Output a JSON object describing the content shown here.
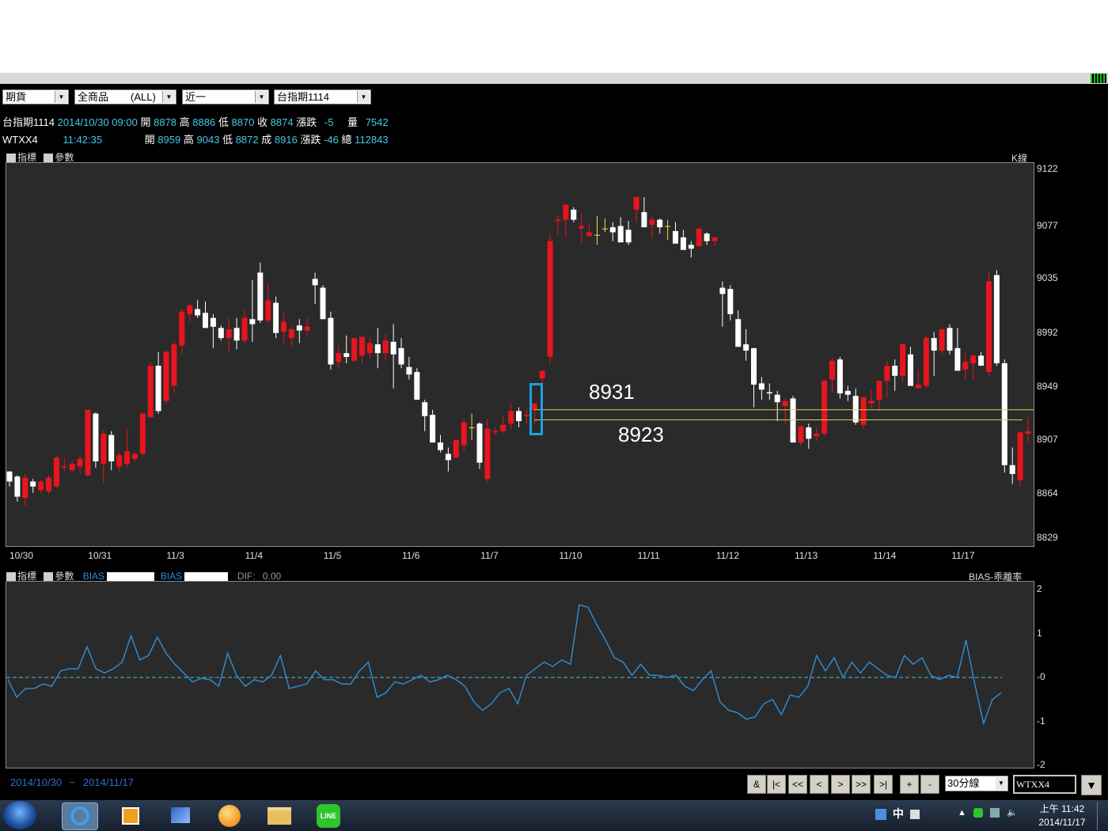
{
  "toolbar": {
    "market": "期貨",
    "products": "全商品",
    "products_filter": "(ALL)",
    "period": "近一",
    "symbol": "台指期1114"
  },
  "quotes": {
    "row1": {
      "name": "台指期1114",
      "datetime": "2014/10/30 09:00",
      "open_label": "開",
      "open": "8878",
      "high_label": "高",
      "high": "8886",
      "low_label": "低",
      "low": "8870",
      "close_label": "收",
      "close": "8874",
      "change_label": "漲跌",
      "change": "-5",
      "volume_label": "量",
      "volume": "7542"
    },
    "row2": {
      "name": "WTXX4",
      "time": "11:42:35",
      "open_label": "開",
      "open": "8959",
      "high_label": "高",
      "high": "9043",
      "low_label": "低",
      "low": "8872",
      "close_label": "成",
      "close": "8916",
      "change_label": "漲跌",
      "change": "-46",
      "volume_label": "總",
      "volume": "112843"
    }
  },
  "main_panel": {
    "indicator_btn": "指標",
    "param_btn": "參數",
    "chart_label": "K線",
    "y_ticks": [
      "9122",
      "9077",
      "9035",
      "8992",
      "8949",
      "8907",
      "8864",
      "8829"
    ],
    "annotation_high": "8931",
    "annotation_low": "8923"
  },
  "sub_panel": {
    "indicator_btn": "指標",
    "param_btn": "參數",
    "bias1_label": "BIAS",
    "bias2_label": "BIAS",
    "dif_label": "DIF:",
    "dif_value": "0.00",
    "chart_label": "BIAS-乖離率",
    "y_ticks": [
      "2",
      "1",
      "-0",
      "-1",
      "-2"
    ]
  },
  "footer": {
    "range_start": "2014/10/30",
    "range_sep": "~",
    "range_end": "2014/11/17",
    "nav": [
      "&",
      "|<",
      "<<",
      "<",
      ">",
      ">>",
      ">|",
      "+",
      "-"
    ],
    "interval": "30分線",
    "symbol_input": "WTXX4"
  },
  "taskbar": {
    "ime": "中",
    "time": "上午 11:42",
    "date": "2014/11/17"
  },
  "colors": {
    "up": "#e8141e",
    "down": "#ffffff",
    "flat": "#f0e040",
    "panel_bg": "#2a2a2a",
    "bias_line": "#2f8fd8",
    "zero_line": "#3fc6d9",
    "highlight_box": "#1da0e0",
    "level_lines": "#d8d040"
  },
  "chart_data": {
    "type": "candlestick",
    "title": "",
    "symbol": "台指期1114",
    "interval": "30分線",
    "x_dates": [
      "10/30",
      "10/31",
      "11/3",
      "11/4",
      "11/5",
      "11/6",
      "11/7",
      "11/10",
      "11/11",
      "11/12",
      "11/13",
      "11/14",
      "11/17"
    ],
    "ylim": [
      8829,
      9122
    ],
    "levels": [
      8931,
      8923
    ],
    "candles": [
      [
        8882,
        8882,
        8870,
        8874
      ],
      [
        8878,
        8879,
        8858,
        8862
      ],
      [
        8861,
        8880,
        8855,
        8877
      ],
      [
        8874,
        8876,
        8865,
        8870
      ],
      [
        8867,
        8875,
        8865,
        8874
      ],
      [
        8866,
        8879,
        8864,
        8877
      ],
      [
        8870,
        8894,
        8869,
        8893
      ],
      [
        8885,
        8892,
        8882,
        8886
      ],
      [
        8883,
        8891,
        8882,
        8888
      ],
      [
        8886,
        8895,
        8880,
        8892
      ],
      [
        8879,
        8930,
        8878,
        8931
      ],
      [
        8928,
        8929,
        8885,
        8890
      ],
      [
        8888,
        8915,
        8873,
        8912
      ],
      [
        8911,
        8914,
        8883,
        8890
      ],
      [
        8886,
        8897,
        8882,
        8895
      ],
      [
        8888,
        8916,
        8885,
        8898
      ],
      [
        8892,
        8897,
        8890,
        8896
      ],
      [
        8896,
        8929,
        8894,
        8928
      ],
      [
        8925,
        8969,
        8925,
        8966
      ],
      [
        8966,
        8977,
        8928,
        8930
      ],
      [
        8938,
        8978,
        8936,
        8977
      ],
      [
        8950,
        8985,
        8944,
        8983
      ],
      [
        8982,
        9011,
        8975,
        9009
      ],
      [
        9007,
        9016,
        9001,
        9014
      ],
      [
        9011,
        9018,
        9004,
        9006
      ],
      [
        9008,
        9017,
        8996,
        8996
      ],
      [
        9004,
        9007,
        8980,
        8997
      ],
      [
        8996,
        8998,
        8986,
        8988
      ],
      [
        8988,
        9004,
        8976,
        8995
      ],
      [
        8996,
        9004,
        8979,
        8986
      ],
      [
        8986,
        9010,
        8984,
        9004
      ],
      [
        9003,
        9034,
        8985,
        8999
      ],
      [
        9040,
        9048,
        9000,
        9002
      ],
      [
        9002,
        9031,
        9000,
        9018
      ],
      [
        9016,
        9021,
        8988,
        8992
      ],
      [
        8993,
        9008,
        8984,
        9001
      ],
      [
        8988,
        8997,
        8982,
        8995
      ],
      [
        8998,
        9003,
        8984,
        8994
      ],
      [
        8994,
        9004,
        8990,
        8997
      ],
      [
        9035,
        9040,
        9015,
        9030
      ],
      [
        9028,
        9030,
        9003,
        9003
      ],
      [
        9004,
        9009,
        8963,
        8967
      ],
      [
        8969,
        8982,
        8964,
        8976
      ],
      [
        8976,
        8990,
        8968,
        8973
      ],
      [
        8970,
        8983,
        8969,
        8988
      ],
      [
        8974,
        8989,
        8968,
        8989
      ],
      [
        8976,
        8988,
        8972,
        8984
      ],
      [
        8983,
        8996,
        8964,
        8976
      ],
      [
        8976,
        8991,
        8970,
        8986
      ],
      [
        8985,
        8999,
        8948,
        8975
      ],
      [
        8980,
        8988,
        8964,
        8967
      ],
      [
        8965,
        8973,
        8955,
        8959
      ],
      [
        8961,
        8964,
        8939,
        8939
      ],
      [
        8937,
        8939,
        8914,
        8926
      ],
      [
        8927,
        8931,
        8905,
        8905
      ],
      [
        8905,
        8911,
        8897,
        8899
      ],
      [
        8896,
        8901,
        8882,
        8891
      ],
      [
        8893,
        8906,
        8899,
        8907
      ],
      [
        8903,
        8924,
        8898,
        8921
      ],
      [
        8917,
        8928,
        8907,
        8917
      ],
      [
        8920,
        8921,
        8884,
        8889
      ],
      [
        8876,
        8924,
        8873,
        8916
      ],
      [
        8913,
        8917,
        8911,
        8914
      ],
      [
        8914,
        8926,
        8913,
        8919
      ],
      [
        8920,
        8936,
        8916,
        8930
      ],
      [
        8930,
        8933,
        8917,
        8922
      ],
      [
        8926,
        8931,
        8920,
        8927
      ],
      [
        8931,
        8932,
        8920,
        8936
      ],
      [
        8956,
        8962,
        8947,
        8962
      ],
      [
        8973,
        9070,
        8967,
        9065
      ],
      [
        9081,
        9085,
        9070,
        9082
      ],
      [
        9082,
        9087,
        9068,
        9094
      ],
      [
        9090,
        9092,
        9080,
        9082
      ],
      [
        9075,
        9087,
        9063,
        9077
      ],
      [
        9069,
        9079,
        9069,
        9072
      ],
      [
        9070,
        9085,
        9062,
        9070
      ],
      [
        9075,
        9083,
        9072,
        9075
      ],
      [
        9076,
        9080,
        9065,
        9072
      ],
      [
        9077,
        9084,
        9064,
        9064
      ],
      [
        9074,
        9081,
        9062,
        9064
      ],
      [
        9090,
        9100,
        9080,
        9100
      ],
      [
        9088,
        9100,
        9078,
        9076
      ],
      [
        9078,
        9085,
        9067,
        9082
      ],
      [
        9082,
        9083,
        9071,
        9076
      ],
      [
        9077,
        9082,
        9066,
        9077
      ],
      [
        9073,
        9080,
        9068,
        9063
      ],
      [
        9068,
        9074,
        9060,
        9058
      ],
      [
        9062,
        9065,
        9052,
        9059
      ],
      [
        9061,
        9073,
        9060,
        9075
      ],
      [
        9071,
        9072,
        9062,
        9065
      ],
      [
        9065,
        9068,
        9061,
        9068
      ],
      [
        9028,
        9033,
        8997,
        9023
      ],
      [
        9027,
        9030,
        9002,
        9007
      ],
      [
        9003,
        9010,
        8983,
        8981
      ],
      [
        8983,
        8995,
        8970,
        8978
      ],
      [
        8980,
        8980,
        8933,
        8951
      ],
      [
        8952,
        8957,
        8939,
        8947
      ],
      [
        8945,
        8952,
        8939,
        8944
      ],
      [
        8943,
        8946,
        8922,
        8937
      ],
      [
        8934,
        8940,
        8920,
        8938
      ],
      [
        8940,
        8942,
        8905,
        8905
      ],
      [
        8905,
        8917,
        8902,
        8918
      ],
      [
        8917,
        8920,
        8900,
        8908
      ],
      [
        8910,
        8917,
        8906,
        8912
      ],
      [
        8912,
        8955,
        8910,
        8954
      ],
      [
        8955,
        8972,
        8945,
        8970
      ],
      [
        8971,
        8973,
        8940,
        8944
      ],
      [
        8946,
        8950,
        8938,
        8943
      ],
      [
        8942,
        8948,
        8919,
        8921
      ],
      [
        8919,
        8941,
        8916,
        8941
      ],
      [
        8936,
        8947,
        8932,
        8938
      ],
      [
        8939,
        8946,
        8930,
        8954
      ],
      [
        8954,
        8970,
        8941,
        8966
      ],
      [
        8966,
        8971,
        8946,
        8958
      ],
      [
        8958,
        8984,
        8953,
        8983
      ],
      [
        8975,
        8981,
        8953,
        8950
      ],
      [
        8948,
        8963,
        8948,
        8951
      ],
      [
        8950,
        8990,
        8948,
        8988
      ],
      [
        8988,
        8993,
        8958,
        8978
      ],
      [
        8978,
        8996,
        8975,
        8995
      ],
      [
        8996,
        8999,
        8975,
        8978
      ],
      [
        8980,
        8996,
        8968,
        8962
      ],
      [
        8963,
        8976,
        8955,
        8969
      ],
      [
        8968,
        8975,
        8955,
        8974
      ],
      [
        8974,
        8977,
        8966,
        8966
      ],
      [
        8961,
        9040,
        8958,
        9033
      ],
      [
        9038,
        9042,
        8966,
        8968
      ],
      [
        8968,
        8971,
        8881,
        8887
      ],
      [
        8887,
        8901,
        8872,
        8880
      ],
      [
        8875,
        8914,
        8870,
        8913
      ],
      [
        8912,
        8925,
        8905,
        8914
      ],
      [
        8915,
        8925,
        8911,
        8916
      ]
    ],
    "bias": [
      -0.05,
      -0.45,
      -0.25,
      -0.25,
      -0.15,
      -0.2,
      0.15,
      0.2,
      0.2,
      0.7,
      0.2,
      0.1,
      0.2,
      0.35,
      0.95,
      0.4,
      0.5,
      0.92,
      0.55,
      0.3,
      0.1,
      -0.1,
      -0.02,
      -0.05,
      -0.2,
      0.55,
      0.05,
      -0.2,
      -0.05,
      -0.1,
      0.05,
      0.5,
      -0.25,
      -0.2,
      -0.15,
      0.15,
      -0.05,
      -0.05,
      -0.15,
      -0.15,
      0.15,
      0.35,
      -0.45,
      -0.35,
      -0.1,
      -0.15,
      -0.05,
      0.05,
      -0.1,
      -0.05,
      0.05,
      -0.05,
      -0.2,
      -0.55,
      -0.75,
      -0.6,
      -0.35,
      -0.25,
      -0.6,
      0.05,
      0.2,
      0.35,
      0.25,
      0.4,
      0.3,
      1.65,
      1.6,
      1.2,
      0.85,
      0.45,
      0.35,
      0.05,
      0.3,
      0.05,
      0.05,
      0.0,
      0.05,
      -0.2,
      -0.3,
      -0.05,
      0.15,
      -0.55,
      -0.75,
      -0.8,
      -0.95,
      -0.9,
      -0.6,
      -0.5,
      -0.85,
      -0.4,
      -0.45,
      -0.2,
      0.5,
      0.15,
      0.45,
      0.0,
      0.35,
      0.1,
      0.35,
      0.2,
      0.05,
      0.0,
      0.5,
      0.3,
      0.45,
      0.05,
      -0.05,
      0.05,
      0.0,
      0.85,
      -0.15,
      -1.05,
      -0.5,
      -0.35
    ]
  }
}
